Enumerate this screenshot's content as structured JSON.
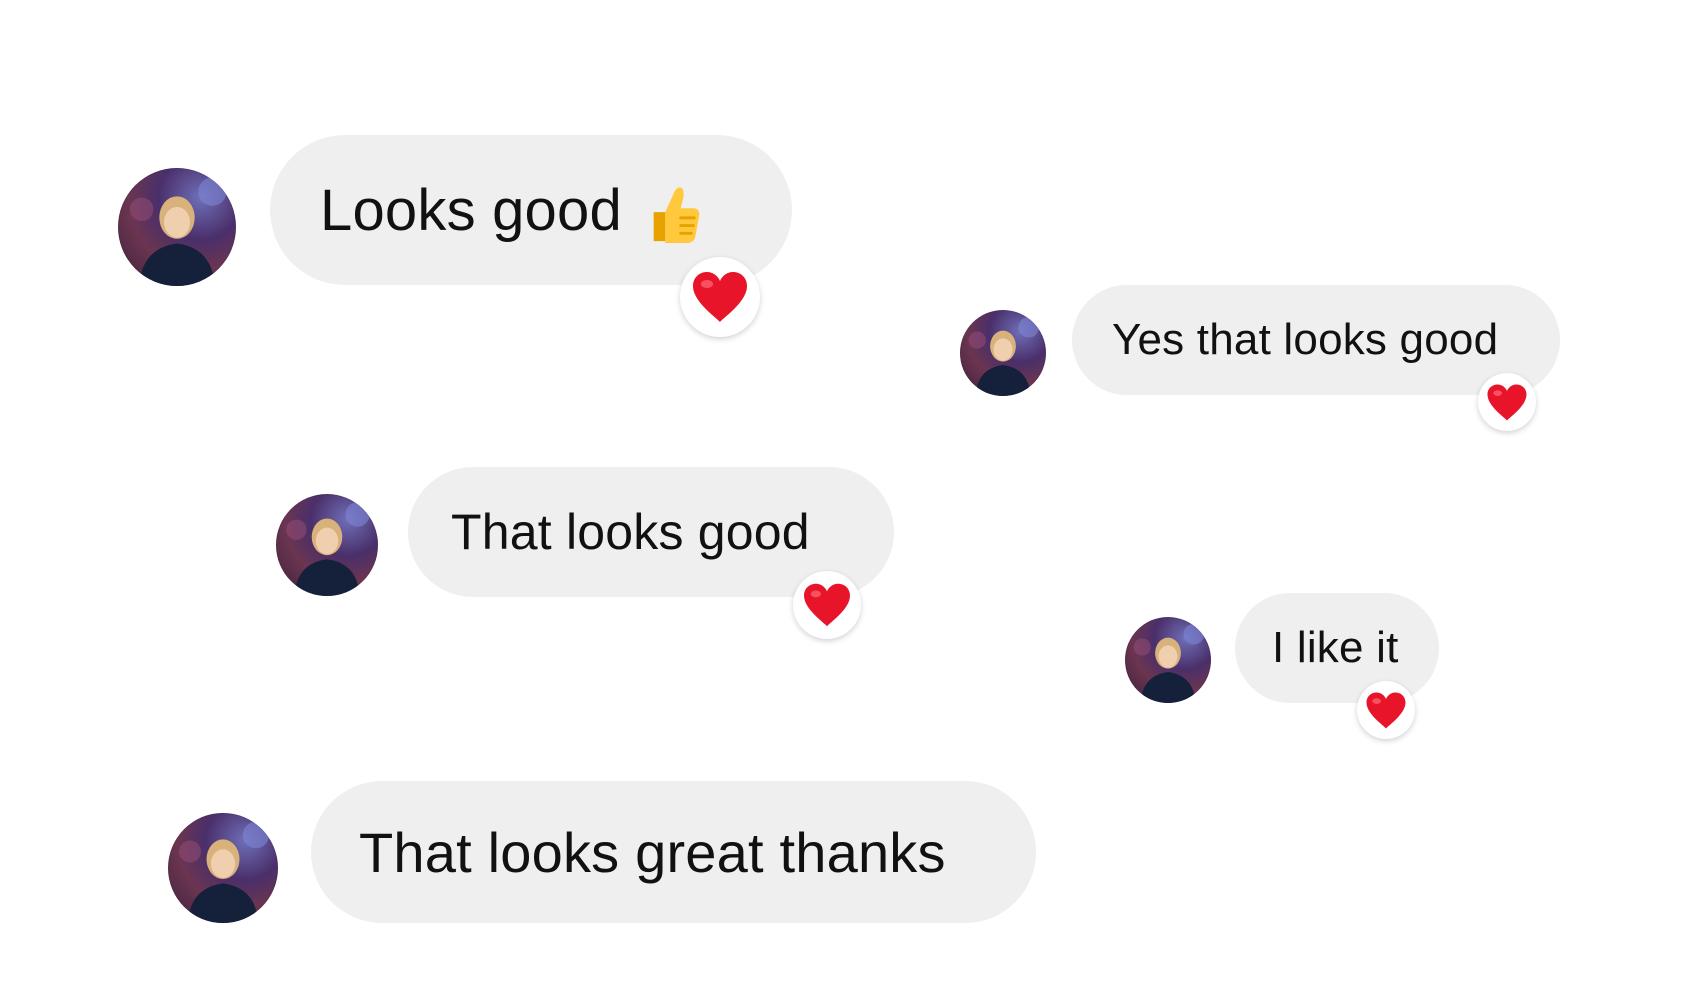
{
  "conversation": {
    "messages": [
      {
        "text": "Looks good",
        "emoji": "thumbs-up",
        "reaction": "red-heart"
      },
      {
        "text": "Yes that looks good",
        "reaction": "red-heart"
      },
      {
        "text": "That looks good",
        "reaction": "red-heart"
      },
      {
        "text": "I like it",
        "reaction": "red-heart"
      },
      {
        "text": "That looks great thanks"
      }
    ]
  },
  "colors": {
    "bubble": "#efefef",
    "text": "#111111",
    "heart": "#e8142a",
    "background": "#ffffff"
  }
}
